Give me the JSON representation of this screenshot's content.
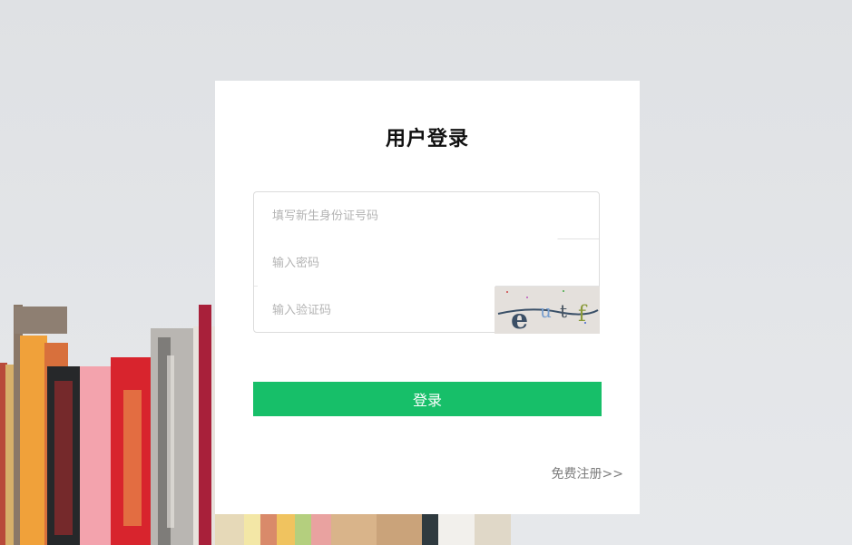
{
  "login_card": {
    "title": "用户登录",
    "id_field": {
      "placeholder": "填写新生身份证号码",
      "value": ""
    },
    "password_field": {
      "placeholder": "输入密码",
      "value": ""
    },
    "captcha_field": {
      "placeholder": "输入验证码",
      "value": ""
    },
    "captcha_image": {
      "text": "eutf"
    },
    "login_button": {
      "label": "登录"
    },
    "register_link": {
      "label": "免费注册>>"
    }
  },
  "colors": {
    "accent": "#17bf69",
    "card_background": "#ffffff",
    "page_background": "#e1e3e6"
  }
}
